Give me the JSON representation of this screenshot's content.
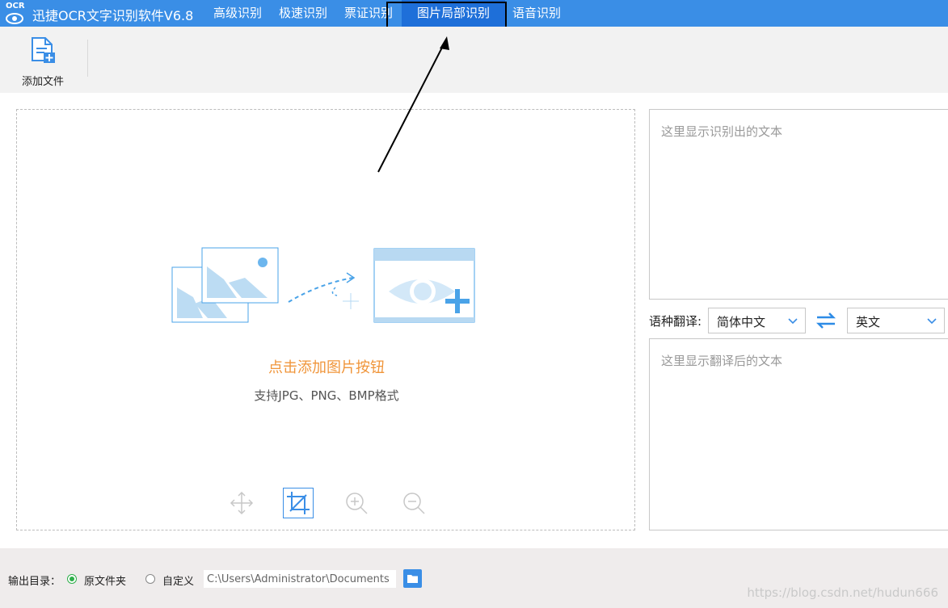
{
  "app": {
    "logo_text": "OCR",
    "title": "迅捷OCR文字识别软件V6.8"
  },
  "tabs": [
    {
      "label": "高级识别"
    },
    {
      "label": "极速识别"
    },
    {
      "label": "票证识别"
    },
    {
      "label": "图片局部识别",
      "active": true
    },
    {
      "label": "语音识别"
    }
  ],
  "toolbar": {
    "add_file_label": "添加文件"
  },
  "image_area": {
    "prompt": "点击添加图片按钮",
    "formats_hint": "支持JPG、PNG、BMP格式",
    "tools": [
      "move-icon",
      "crop-icon",
      "zoom-in-icon",
      "zoom-out-icon"
    ]
  },
  "ocr_result": {
    "placeholder": "这里显示识别出的文本"
  },
  "translation": {
    "label": "语种翻译:",
    "source_lang": "简体中文",
    "target_lang": "英文",
    "placeholder": "这里显示翻译后的文本"
  },
  "bottom": {
    "output_label": "输出目录：",
    "option_original": "原文件夹",
    "option_custom": "自定义",
    "path_value": "C:\\Users\\Administrator\\Documents",
    "selected": "original"
  },
  "watermark": "https://blog.csdn.net/hudun666",
  "colors": {
    "title_bar": "#3a8ee6",
    "active_tab": "#1e6fd9",
    "prompt": "#f0953a",
    "icon_blue": "#4aa3e8"
  }
}
